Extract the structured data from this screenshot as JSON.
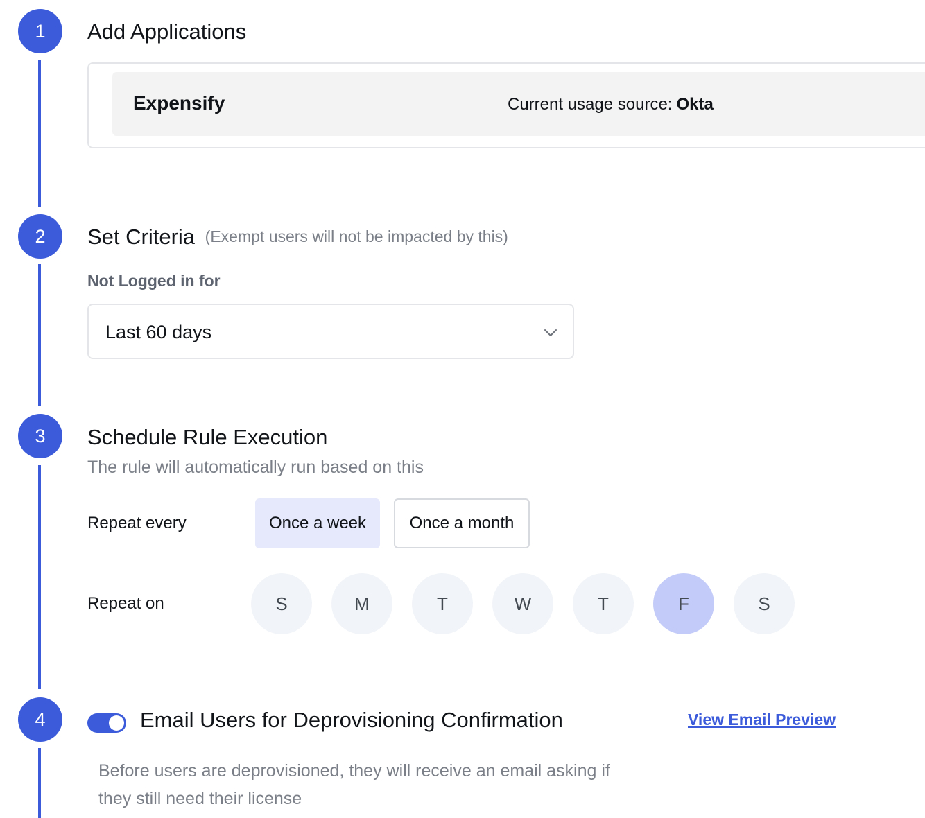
{
  "steps": [
    {
      "number": "1",
      "title": "Add Applications"
    },
    {
      "number": "2",
      "title": "Set Criteria",
      "note": "(Exempt users will not be impacted by this)"
    },
    {
      "number": "3",
      "title": "Schedule Rule Execution",
      "subtitle": "The rule will automatically run based on this"
    },
    {
      "number": "4",
      "title": "Email Users for Deprovisioning Confirmation"
    }
  ],
  "applications": [
    {
      "name": "Expensify",
      "usage_label": "Current usage source:",
      "usage_source": "Okta"
    }
  ],
  "criteria": {
    "label": "Not Logged in for",
    "selected": "Last 60 days"
  },
  "schedule": {
    "repeat_every_label": "Repeat every",
    "options": [
      "Once a week",
      "Once a month"
    ],
    "selected_option": "Once a week",
    "repeat_on_label": "Repeat on",
    "days": [
      "S",
      "M",
      "T",
      "W",
      "T",
      "F",
      "S"
    ],
    "selected_day_index": 5
  },
  "email": {
    "toggle_on": true,
    "preview_link": "View Email Preview",
    "description_line1": "Before users are deprovisioned, they will receive an email asking if",
    "description_line2": "they still need their license"
  },
  "colors": {
    "accent": "#3b5bdb",
    "selected_option_bg": "#e6e9fb",
    "selected_day_bg": "#c3cbf8",
    "day_bg": "#f1f4f8"
  }
}
